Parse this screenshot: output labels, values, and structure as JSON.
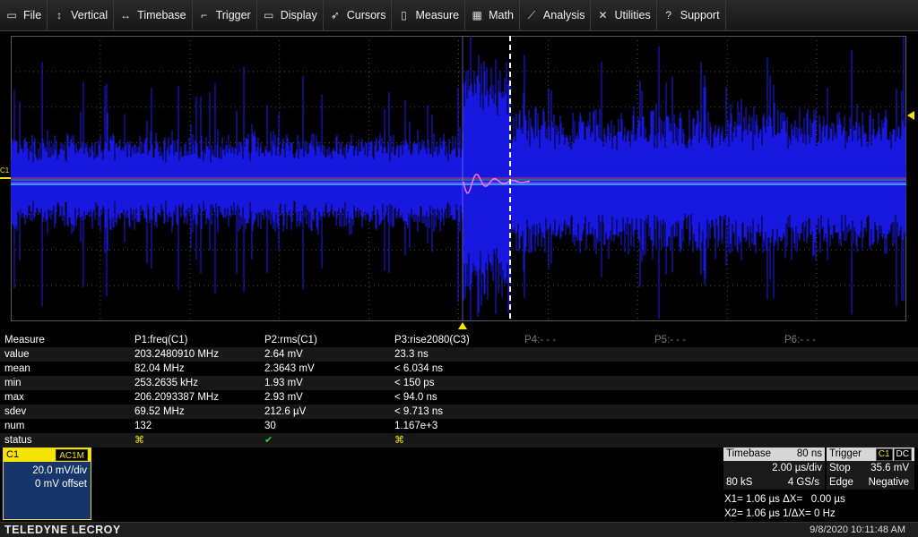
{
  "menu": [
    {
      "label": "File",
      "icon": "file-icon",
      "glyph": "▭"
    },
    {
      "label": "Vertical",
      "icon": "vertical-arrows-icon",
      "glyph": "↕"
    },
    {
      "label": "Timebase",
      "icon": "horizontal-arrows-icon",
      "glyph": "↔"
    },
    {
      "label": "Trigger",
      "icon": "trigger-icon",
      "glyph": "⌐"
    },
    {
      "label": "Display",
      "icon": "display-icon",
      "glyph": "▭"
    },
    {
      "label": "Cursors",
      "icon": "cursors-icon",
      "glyph": "➶"
    },
    {
      "label": "Measure",
      "icon": "measure-icon",
      "glyph": "▯"
    },
    {
      "label": "Math",
      "icon": "calculator-icon",
      "glyph": "▦"
    },
    {
      "label": "Analysis",
      "icon": "analysis-icon",
      "glyph": "⟋"
    },
    {
      "label": "Utilities",
      "icon": "wrench-icon",
      "glyph": "✕"
    },
    {
      "label": "Support",
      "icon": "help-icon",
      "glyph": "?"
    }
  ],
  "trace": {
    "label": "C1",
    "color": "#1818e0",
    "marker_color": "#f5e400"
  },
  "measure": {
    "header": [
      "Measure",
      "P1:freq(C1)",
      "P2:rms(C1)",
      "P3:rise2080(C3)",
      "P4:- - -",
      "P5:- - -",
      "P6:- - -"
    ],
    "rows": [
      {
        "label": "value",
        "p1": "203.2480910 MHz",
        "p2": "2.64 mV",
        "p3": "23.3 ns"
      },
      {
        "label": "mean",
        "p1": "82.04 MHz",
        "p2": "2.3643 mV",
        "p3": "< 6.034 ns"
      },
      {
        "label": "min",
        "p1": "253.2635 kHz",
        "p2": "1.93 mV",
        "p3": "< 150 ps"
      },
      {
        "label": "max",
        "p1": "206.2093387 MHz",
        "p2": "2.93 mV",
        "p3": "< 94.0 ns"
      },
      {
        "label": "sdev",
        "p1": "69.52 MHz",
        "p2": "212.6 µV",
        "p3": "< 9.713 ns"
      },
      {
        "label": "num",
        "p1": "132",
        "p2": "30",
        "p3": "1.167e+3"
      },
      {
        "label": "status",
        "p1": "⌘",
        "p2": "✔",
        "p3": "⌘"
      }
    ]
  },
  "channel": {
    "name": "C1",
    "coupling": "AC1M",
    "scale": "20.0 mV/div",
    "offset": "0 mV offset"
  },
  "timebase": {
    "title": "Timebase",
    "delay": "80 ns",
    "per_div": "2.00 µs/div",
    "samples": "80 kS",
    "rate": "4 GS/s"
  },
  "trigger": {
    "title": "Trigger",
    "source": "C1",
    "coupling": "DC",
    "mode": "Stop",
    "level": "35.6 mV",
    "type": "Edge",
    "slope": "Negative"
  },
  "cursors": {
    "x1": "X1= 1.06 µs ΔX=   0.00 µs",
    "x2": "X2= 1.06 µs 1/ΔX= 0 Hz"
  },
  "footer": {
    "brand": "TELEDYNE LECROY",
    "datetime": "9/8/2020 10:11:48 AM"
  }
}
